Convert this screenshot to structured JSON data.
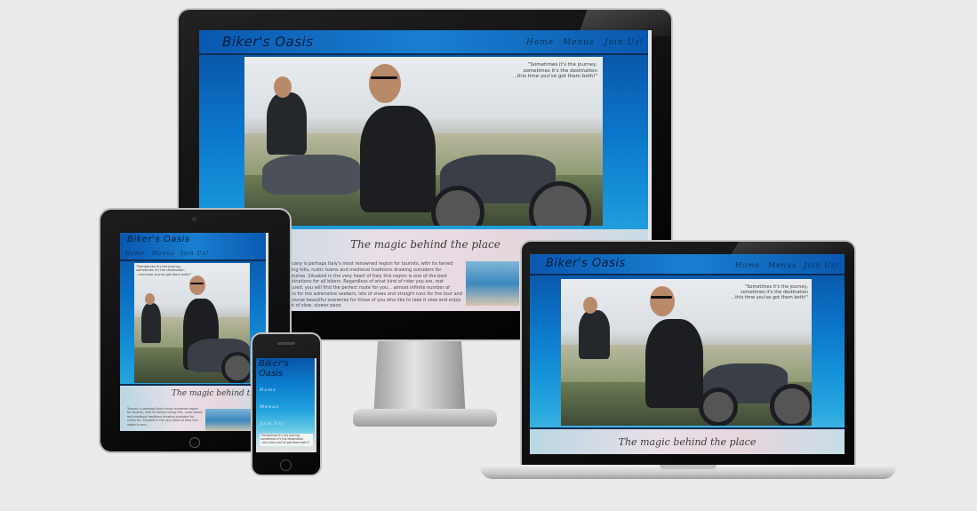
{
  "site": {
    "brand": "Biker's Oasis",
    "nav": [
      "Home",
      "Menus",
      "Join Us!"
    ],
    "quote": [
      "\"Sometimes it's the journey,",
      "sometimes it's the destination",
      "...this time you've got them both!\""
    ],
    "tagline": "The magic behind the place",
    "paragraph": "Tuscany is perhaps Italy's most renowned region for tourists, with its famed rolling hills, rustic towns and medieval traditions drawing outsiders for centuries. Situated in the very heart of Italy this region is one of the best destinations for all bikers. Regardless of what kind of rider you are, rest assured, you will find the perfect route for you... almost infinite number of turns for the adrenaline seekers, lots of views and straight runs for the tour and of course beautiful sceneries for those of you who like to take it slow and enjoy a lot of slow, slower pace.",
    "tablet_paragraph": "Tuscany is perhaps Italy's most renowned region for tourists, with its famed rolling hills, rustic towns and medieval traditions drawing outsiders for centuries. Situated in the very heart of Italy this region is one..."
  },
  "phone": {
    "brand_line1": "Biker's",
    "brand_line2": "Oasis"
  }
}
